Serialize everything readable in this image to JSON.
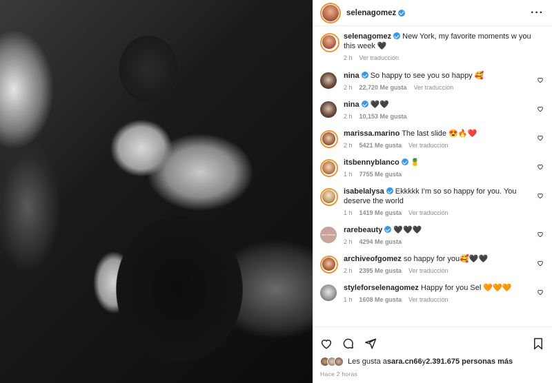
{
  "post": {
    "author": "selenagomez",
    "caption": "New York, my favorite moments w you this week 🖤",
    "caption_time": "2 h",
    "caption_translate": "Ver traducción"
  },
  "comments": [
    {
      "user": "nina",
      "text": "So happy to see you so happy 🥰",
      "time": "2 h",
      "likes": "22,720 Me gusta",
      "translate": "Ver traducción"
    },
    {
      "user": "nina",
      "text": "🖤🖤",
      "time": "2 h",
      "likes": "10,153 Me gusta",
      "translate": ""
    },
    {
      "user": "marissa.marino",
      "text": "The last slide 😍🔥❤️",
      "time": "2 h",
      "likes": "5421 Me gusta",
      "translate": "Ver traducción"
    },
    {
      "user": "itsbennyblanco",
      "text": "🍍",
      "time": "1 h",
      "likes": "7755 Me gusta",
      "translate": ""
    },
    {
      "user": "isabelalysa",
      "text": "Ekkkkk I'm so so happy for you. You deserve the world",
      "time": "1 h",
      "likes": "1419 Me gusta",
      "translate": "Ver traducción"
    },
    {
      "user": "rarebeauty",
      "text": "🖤🖤🖤",
      "time": "2 h",
      "likes": "4294 Me gusta",
      "translate": ""
    },
    {
      "user": "archiveofgomez",
      "text": "so happy for you🥰🖤🖤",
      "time": "2 h",
      "likes": "2395 Me gusta",
      "translate": "Ver traducción"
    },
    {
      "user": "styleforselenagomez",
      "text": "Happy for you Sel 🧡🧡🧡",
      "time": "1 h",
      "likes": "1608 Me gusta",
      "translate": "Ver traducción"
    }
  ],
  "likes": {
    "prefix": "Les gusta a ",
    "user": "sara.cn66",
    "middle": " y ",
    "count": "2.391.675 personas más"
  },
  "posted_ago": "Hace 2 horas",
  "rarebeauty_avatar_text": "rare beauty",
  "icons": [
    "more-icon",
    "verified-icon",
    "heart-icon",
    "comment-icon",
    "share-icon",
    "bookmark-icon"
  ],
  "colors": {
    "verified": "#3897f0",
    "meta": "#8e8e8e",
    "text": "#262626"
  }
}
